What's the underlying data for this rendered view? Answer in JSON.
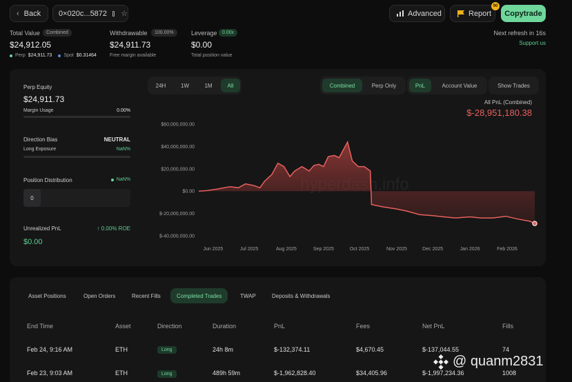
{
  "header": {
    "back_label": "Back",
    "address": "0×020c...5872",
    "advanced_label": "Advanced",
    "report_label": "Report",
    "report_badge": "90",
    "copytrade_label": "Copytrade"
  },
  "summary": {
    "total_value_label": "Total Value",
    "total_value_badge": "Combined",
    "total_value": "$24,912.05",
    "perp_label": "Perp",
    "perp_value": "$24,911.73",
    "spot_label": "Spot",
    "spot_value": "$0.31464",
    "withdrawable_label": "Withdrawable",
    "withdrawable_badge": "100.00%",
    "withdrawable_value": "$24,911.73",
    "withdrawable_sub": "Free margin available",
    "leverage_label": "Leverage",
    "leverage_badge": "0.00x",
    "leverage_value": "$0.00",
    "leverage_sub": "Total position value",
    "refresh_text": "Next refresh in 16s",
    "support_link": "Support us"
  },
  "left_panel": {
    "perp_equity_label": "Perp Equity",
    "perp_equity_value": "$24,911.73",
    "margin_usage_label": "Margin Usage",
    "margin_usage_value": "0.00%",
    "direction_bias_label": "Direction Bias",
    "direction_bias_value": "NEUTRAL",
    "long_exposure_label": "Long Exposure",
    "long_exposure_value": "NaN%",
    "position_distribution_label": "Position Distribution",
    "position_distribution_value": "NaN%",
    "position_count": "0",
    "unrealized_pnl_label": "Unrealized PnL",
    "roe_text": "↑ 0.00% ROE",
    "unrealized_pnl_value": "$0.00"
  },
  "chart_controls": {
    "ranges": [
      "24H",
      "1W",
      "1M",
      "All"
    ],
    "active_range": "All",
    "modes": [
      "Combined",
      "Perp Only"
    ],
    "active_mode": "Combined",
    "metrics": [
      "PnL",
      "Account Value"
    ],
    "active_metric": "PnL",
    "show_trades": "Show Trades",
    "pnl_caption": "All PnL (Combined)",
    "pnl_total": "$-28,951,180.38",
    "watermark": "hyperdash.info"
  },
  "colors": {
    "accent_green": "#6fd79c",
    "loss_red": "#e8615d",
    "background": "#0d0d0e",
    "panel": "#161617"
  },
  "chart_data": {
    "type": "area",
    "title": "All PnL (Combined)",
    "xlabel": "",
    "ylabel": "",
    "ylim": [
      -40000000,
      60000000
    ],
    "y_ticks": [
      "$60,000,000.00",
      "$40,000,000.00",
      "$20,000,000.00",
      "$0.00",
      "$-20,000,000.00",
      "$-40,000,000.00"
    ],
    "y_tick_values": [
      60000000,
      40000000,
      20000000,
      0,
      -20000000,
      -40000000
    ],
    "x_ticks": [
      "Jun 2025",
      "Jul 2025",
      "Aug 2025",
      "Sep 2025",
      "Oct 2025",
      "Nov 2025",
      "Dec 2025",
      "Jan 2026",
      "Feb 2026"
    ],
    "x": [
      "2025-05-20",
      "2025-05-27",
      "2025-06-05",
      "2025-06-15",
      "2025-06-22",
      "2025-06-28",
      "2025-07-05",
      "2025-07-10",
      "2025-07-14",
      "2025-07-20",
      "2025-07-25",
      "2025-07-30",
      "2025-08-04",
      "2025-08-08",
      "2025-08-14",
      "2025-08-20",
      "2025-08-24",
      "2025-08-28",
      "2025-09-01",
      "2025-09-05",
      "2025-09-10",
      "2025-09-14",
      "2025-09-18",
      "2025-09-21",
      "2025-09-25",
      "2025-09-30",
      "2025-10-05",
      "2025-10-10",
      "2025-10-11",
      "2025-10-20",
      "2025-11-01",
      "2025-11-10",
      "2025-11-20",
      "2025-12-01",
      "2025-12-10",
      "2025-12-20",
      "2026-01-01",
      "2026-01-10",
      "2026-01-20",
      "2026-01-31",
      "2026-02-10",
      "2026-02-20",
      "2026-02-24"
    ],
    "series": [
      {
        "values": [
          0,
          500000,
          2000000,
          4000000,
          3000000,
          6500000,
          5000000,
          3000000,
          9000000,
          15000000,
          25000000,
          22000000,
          13000000,
          18000000,
          22000000,
          18000000,
          23000000,
          24000000,
          22000000,
          31000000,
          32000000,
          30000000,
          38000000,
          44000000,
          27000000,
          22000000,
          22000000,
          18000000,
          -12000000,
          -14000000,
          -16000000,
          -18000000,
          -21000000,
          -22000000,
          -23000000,
          -24000000,
          -23000000,
          -24000000,
          -24000000,
          -22500000,
          -25000000,
          -27000000,
          -28951180
        ]
      }
    ]
  },
  "bottom_tabs": [
    "Asset Positions",
    "Open Orders",
    "Recent Fills",
    "Completed Trades",
    "TWAP",
    "Deposits & Withdrawals"
  ],
  "active_tab": "Completed Trades",
  "table": {
    "columns": [
      "End Time",
      "Asset",
      "Direction",
      "Duration",
      "PnL",
      "Fees",
      "Net PnL",
      "Fills"
    ],
    "rows": [
      [
        "Feb 24, 9:16 AM",
        "ETH",
        "Long",
        "24h 8m",
        "$-132,374.11",
        "$4,670.45",
        "$-137,044.55",
        "74"
      ],
      [
        "Feb 23, 9:03 AM",
        "ETH",
        "Long",
        "489h 59m",
        "$-1,962,828.40",
        "$34,405.96",
        "$-1,997,234.36",
        "1008"
      ]
    ]
  },
  "overlay_watermark": "@ quanm2831"
}
